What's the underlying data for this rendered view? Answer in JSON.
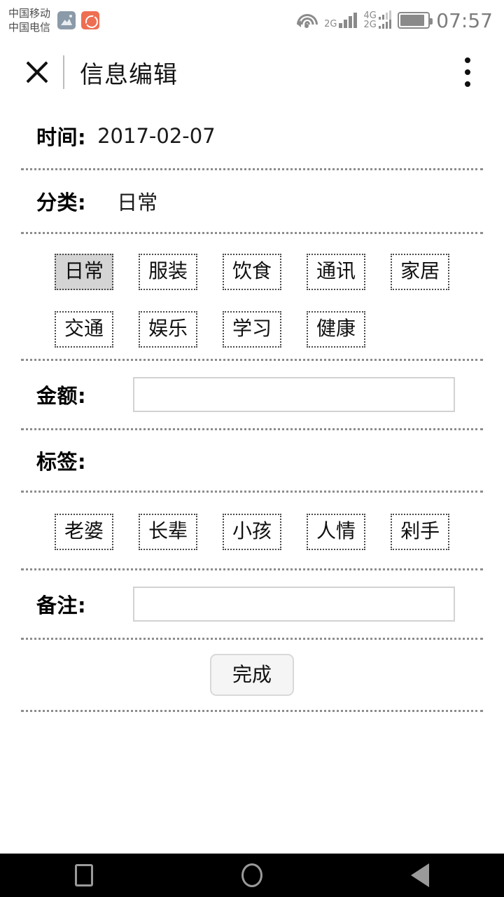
{
  "statusbar": {
    "carrier_1": "中国移动",
    "carrier_2": "中国电信",
    "notif_icons": [
      "image-icon",
      "block-icon"
    ],
    "wifi_icon": "wifi-icon",
    "signal_1_label": "2G",
    "signal_2_label_top": "4G",
    "signal_2_label_bottom": "2G",
    "battery_icon": "battery-icon",
    "time": "07:57"
  },
  "titlebar": {
    "close_icon": "close-icon",
    "title": "信息编辑",
    "more_icon": "more-vertical-icon"
  },
  "form": {
    "time_label": "时间:",
    "time_value": "2017-02-07",
    "category_label": "分类:",
    "category_value": "日常",
    "categories": [
      [
        "日常",
        "服装",
        "饮食",
        "通讯",
        "家居"
      ],
      [
        "交通",
        "娱乐",
        "学习",
        "健康"
      ]
    ],
    "selected_category": "日常",
    "amount_label": "金额:",
    "amount_value": "",
    "amount_placeholder": "",
    "tags_label": "标签:",
    "tags": [
      "老婆",
      "长辈",
      "小孩",
      "人情",
      "剁手"
    ],
    "selected_tags": [],
    "note_label": "备注:",
    "note_value": "",
    "note_placeholder": "",
    "submit_label": "完成"
  },
  "navbar": {
    "recent_icon": "recents-icon",
    "home_icon": "home-icon",
    "back_icon": "back-icon"
  },
  "colors": {
    "selected_chip_bg": "#d4d4d4",
    "chip_border": "#4a4a4a",
    "divider": "#8d8d8d",
    "input_border": "#d2d2d2",
    "button_bg": "#f5f5f5",
    "navbar_bg": "#000000",
    "status_gray": "#8a8a8a"
  }
}
